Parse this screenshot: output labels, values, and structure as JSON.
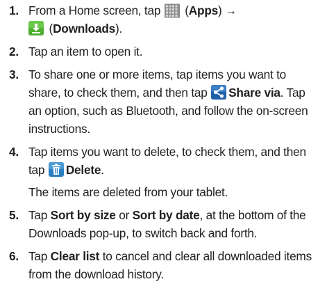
{
  "steps": [
    {
      "number": "1.",
      "line1_pre": "From a Home screen, tap ",
      "apps_label": "Apps",
      "line1_post_open": " (",
      "line1_post_close": ") →",
      "line2_open": " (",
      "downloads_label": "Downloads",
      "line2_close": ")."
    },
    {
      "number": "2.",
      "text": "Tap an item to open it."
    },
    {
      "number": "3.",
      "line1": "To share one or more items, tap items you want to",
      "line2_pre": "share, to check them, and then tap ",
      "share_label": "Share via",
      "line2_post": ". Tap",
      "line3": "an option, such as Bluetooth, and follow the on-screen",
      "line4": "instructions."
    },
    {
      "number": "4.",
      "line1": "Tap items you want to delete, to check them, and then",
      "line2_pre": "tap ",
      "delete_label": "Delete",
      "line2_post": ".",
      "line3": "The items are deleted from your tablet."
    },
    {
      "number": "5.",
      "line1_pre": "Tap ",
      "sort_size_label": "Sort by size",
      "line1_mid": " or ",
      "sort_date_label": "Sort by date",
      "line1_post": ", at the bottom of the",
      "line2": "Downloads pop-up, to switch back and forth."
    },
    {
      "number": "6.",
      "line1_pre": "Tap ",
      "clear_label": "Clear list",
      "line1_post": " to cancel and clear all downloaded items",
      "line2": "from the download history."
    }
  ],
  "icons": {
    "apps": "apps-grid-icon",
    "downloads": "downloads-icon",
    "share": "share-icon",
    "delete": "trash-icon"
  },
  "colors": {
    "text": "#231f20",
    "downloads_icon": "#4caf2f",
    "share_icon": "#1f5fa8",
    "delete_icon": "#2a7fc0",
    "apps_icon": "#9a9a9a"
  }
}
